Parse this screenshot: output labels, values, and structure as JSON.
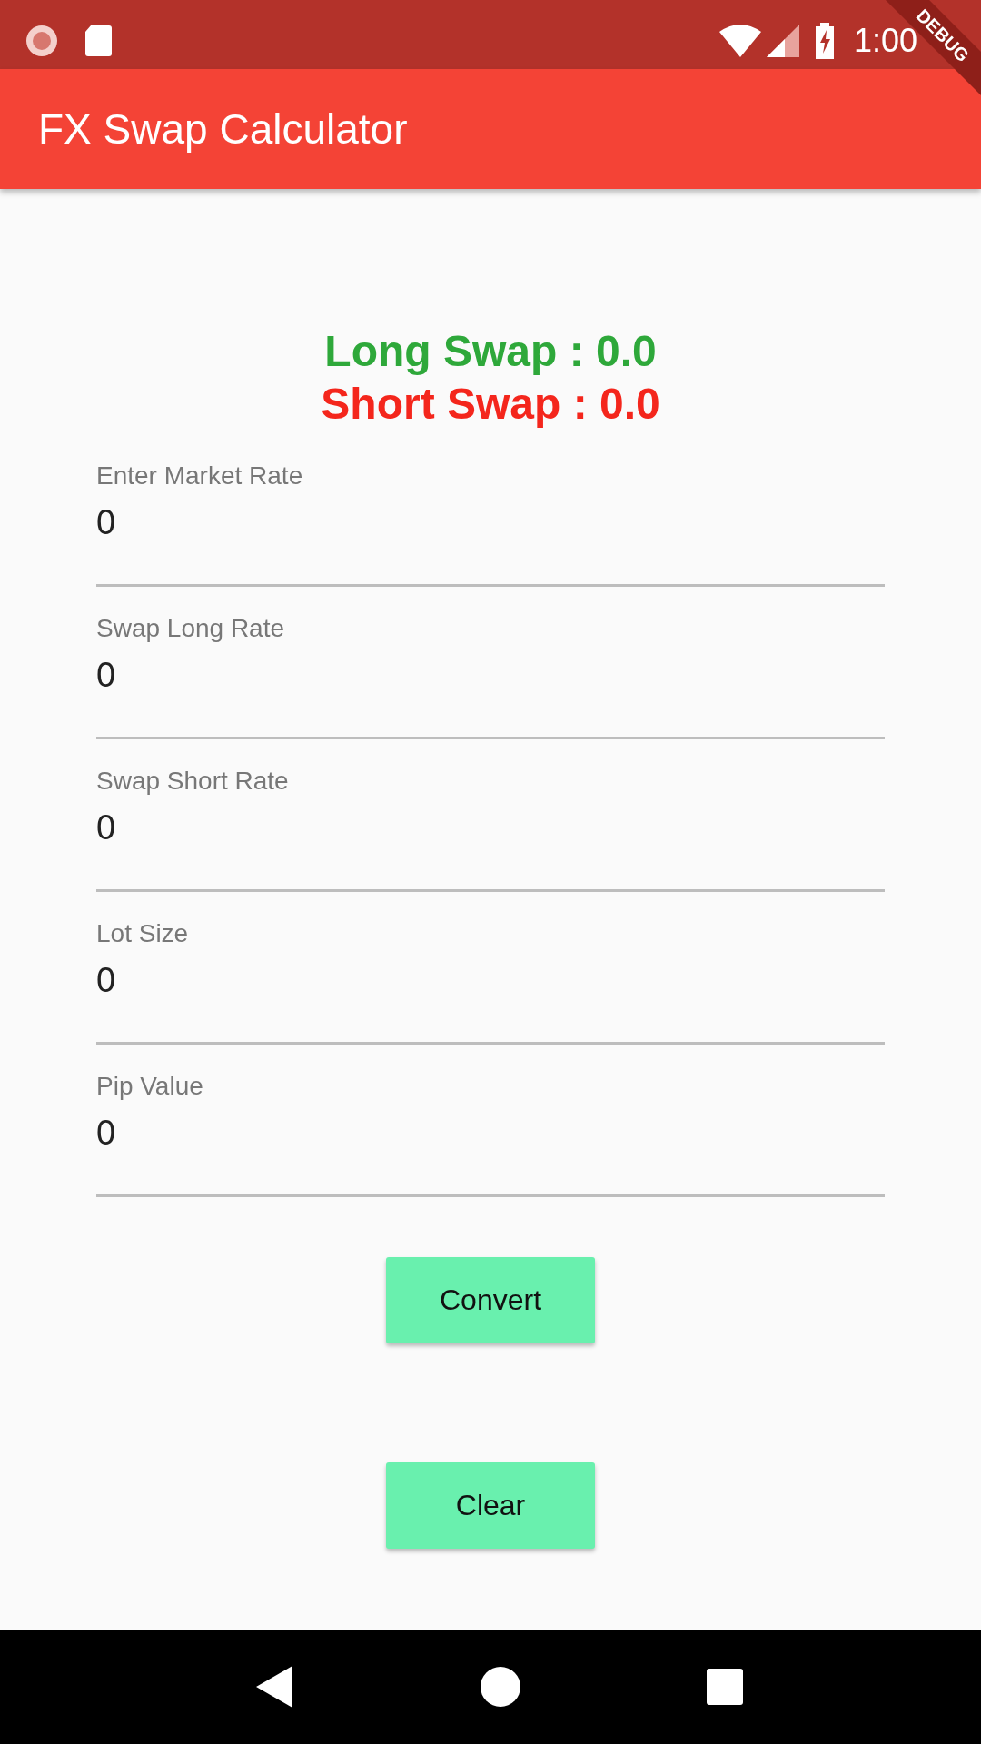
{
  "status_bar": {
    "time": "1:00"
  },
  "debug_banner": {
    "label": "DEBUG"
  },
  "app_bar": {
    "title": "FX Swap Calculator"
  },
  "results": [
    {
      "text": "Long Swap : 0.0",
      "color": "#2ea83a"
    },
    {
      "text": "Short Swap : 0.0",
      "color": "#f4261c"
    }
  ],
  "fields": [
    {
      "label": "Enter Market Rate",
      "value": "0"
    },
    {
      "label": "Swap Long Rate",
      "value": "0"
    },
    {
      "label": "Swap Short Rate",
      "value": "0"
    },
    {
      "label": "Lot Size",
      "value": "0"
    },
    {
      "label": "Pip Value",
      "value": "0"
    }
  ],
  "buttons": [
    {
      "label": "Convert"
    },
    {
      "label": "Clear"
    }
  ]
}
